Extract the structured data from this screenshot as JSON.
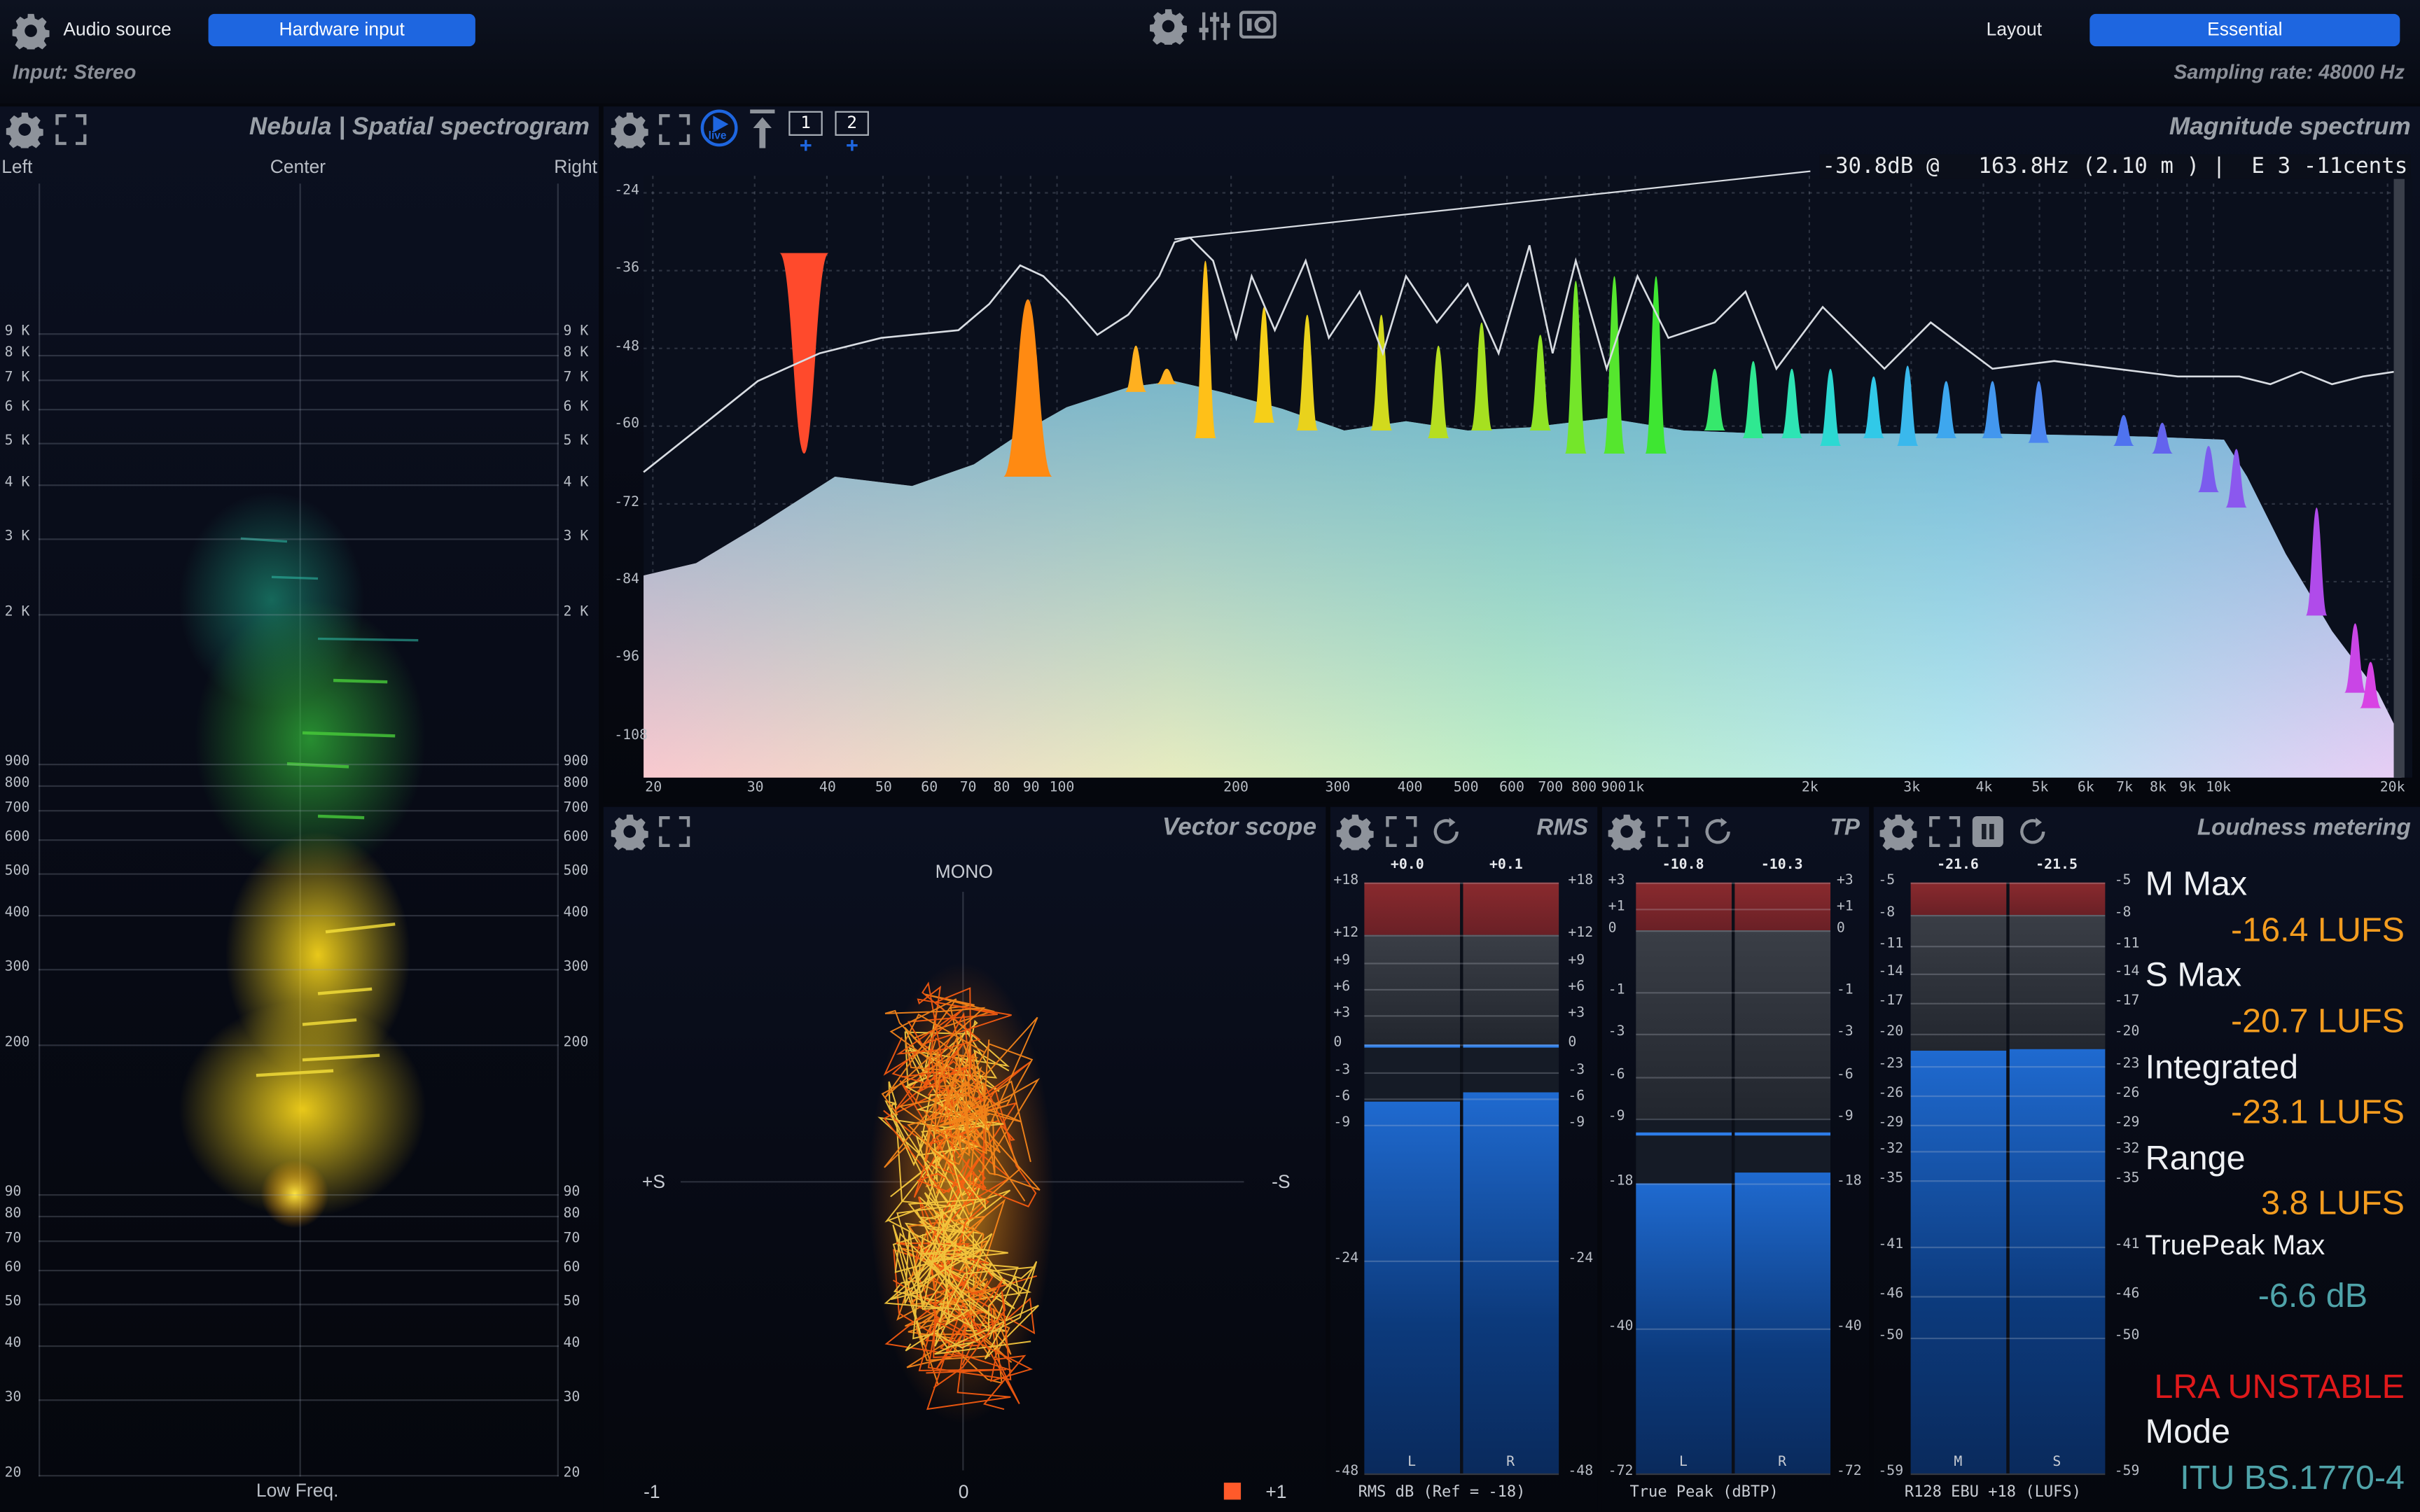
{
  "header": {
    "audio_source_label": "Audio source",
    "audio_source_value": "Hardware input",
    "input_label": "Input: Stereo",
    "layout_label": "Layout",
    "layout_value": "Essential",
    "sampling_rate": "Sampling rate: 48000 Hz"
  },
  "nebula": {
    "title": "Nebula | Spatial spectrogram",
    "left": "Left",
    "center": "Center",
    "right": "Right",
    "bottom": "Low Freq.",
    "freq_labels": [
      "9 K",
      "8 K",
      "7 K",
      "6 K",
      "5 K",
      "4 K",
      "3 K",
      "2 K",
      "900",
      "800",
      "700",
      "600",
      "500",
      "400",
      "300",
      "200",
      "90",
      "80",
      "70",
      "60",
      "50",
      "40",
      "30",
      "20"
    ]
  },
  "spectrum": {
    "title": "Magnitude spectrum",
    "live_label": "live",
    "slot1": "1",
    "slot2": "2",
    "readout": "-30.8dB @   163.8Hz (2.10 m ) |  E 3 -11cents",
    "y_labels": [
      "-24",
      "-36",
      "-48",
      "-60",
      "-72",
      "-84",
      "-96",
      "-108"
    ],
    "x_labels": [
      "20",
      "30",
      "40",
      "50",
      "60",
      "70",
      "80",
      "90",
      "100",
      "200",
      "300",
      "400",
      "500",
      "600",
      "700",
      "800",
      "900",
      "1k",
      "2k",
      "3k",
      "4k",
      "5k",
      "6k",
      "7k",
      "8k",
      "9k",
      "10k",
      "20k"
    ]
  },
  "vectorscope": {
    "title": "Vector scope",
    "mono": "MONO",
    "plus_s": "+S",
    "minus_s": "-S",
    "minus1": "-1",
    "zero": "0",
    "plus1": "+1"
  },
  "rms": {
    "title": "RMS",
    "peak_l": "+0.0",
    "peak_r": "+0.1",
    "scale": [
      "+18",
      "+12",
      "+9",
      "+6",
      "+3",
      "0",
      "-3",
      "-6",
      "-9",
      "-24",
      "-48"
    ],
    "ch_l": "L",
    "ch_r": "R",
    "footer": "RMS dB (Ref = -18)",
    "level_l": -6.3,
    "level_r": -5.4
  },
  "tp": {
    "title": "TP",
    "peak_l": "-10.8",
    "peak_r": "-10.3",
    "scale": [
      "+3",
      "+1",
      "0",
      "-1",
      "-3",
      "-6",
      "-9",
      "-18",
      "-40",
      "-72"
    ],
    "ch_l": "L",
    "ch_r": "R",
    "footer": "True Peak (dBTP)",
    "level_l": -18.0,
    "level_r": -16.5
  },
  "loudness": {
    "title": "Loudness metering",
    "peak_m": "-21.6",
    "peak_s": "-21.5",
    "scale": [
      "-5",
      "-8",
      "-11",
      "-14",
      "-17",
      "-20",
      "-23",
      "-26",
      "-29",
      "-32",
      "-35",
      "-41",
      "-46",
      "-50",
      "-59"
    ],
    "ch_m": "M",
    "ch_s": "S",
    "footer": "R128 EBU +18 (LUFS)",
    "m_max_label": "M Max",
    "m_max_value": "-16.4 LUFS",
    "s_max_label": "S Max",
    "s_max_value": "-20.7 LUFS",
    "integrated_label": "Integrated",
    "integrated_value": "-23.1 LUFS",
    "range_label": "Range",
    "range_value": "3.8 LUFS",
    "truepeak_label": "TruePeak Max",
    "truepeak_value": "-6.6 dB",
    "lra_status": "LRA UNSTABLE",
    "mode_label": "Mode",
    "mode_value": "ITU BS.1770-4"
  },
  "colors": {
    "accent": "#1e66e0",
    "orange": "#f39c1f",
    "red_status": "#e0191b",
    "truepeak": "#4fa3a9",
    "meter_blue": "#1b5fb8"
  }
}
